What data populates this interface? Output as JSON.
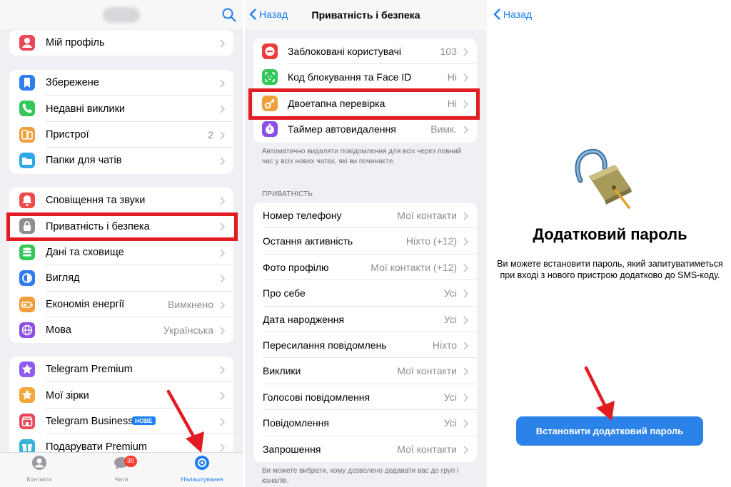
{
  "settings": {
    "profile_group": [
      {
        "label": "Мій профіль",
        "icon": "person-icon",
        "color": "#e9485b",
        "value": ""
      }
    ],
    "group2": [
      {
        "label": "Збережене",
        "icon": "bookmark-icon",
        "color": "#2f7bf0",
        "value": ""
      },
      {
        "label": "Недавні виклики",
        "icon": "phone-icon",
        "color": "#34c759",
        "value": ""
      },
      {
        "label": "Пристрої",
        "icon": "devices-icon",
        "color": "#f0a03a",
        "value": "2"
      },
      {
        "label": "Папки для чатів",
        "icon": "folder-icon",
        "color": "#2fa8e8",
        "value": ""
      }
    ],
    "group3": [
      {
        "label": "Сповіщення та звуки",
        "icon": "bell-icon",
        "color": "#ef4b4b",
        "value": ""
      },
      {
        "label": "Приватність і безпека",
        "icon": "lock-icon",
        "color": "#8e8e93",
        "value": ""
      },
      {
        "label": "Дані та сховище",
        "icon": "database-icon",
        "color": "#34c759",
        "value": ""
      },
      {
        "label": "Вигляд",
        "icon": "appearance-icon",
        "color": "#2f7bf0",
        "value": ""
      },
      {
        "label": "Економія енергії",
        "icon": "battery-icon",
        "color": "#f0a03a",
        "value": "Вимкнено"
      },
      {
        "label": "Мова",
        "icon": "globe-icon",
        "color": "#8e4ee6",
        "value": "Українська"
      }
    ],
    "group4": [
      {
        "label": "Telegram Premium",
        "icon": "premium-star-icon",
        "color": "#8e5cf0",
        "value": ""
      },
      {
        "label": "Мої зірки",
        "icon": "star-icon",
        "color": "#f0a93a",
        "value": ""
      },
      {
        "label": "Telegram Business",
        "icon": "business-icon",
        "color": "#e9485b",
        "value": "",
        "badge": "НОВЕ"
      },
      {
        "label": "Подарувати Premium",
        "icon": "gift-icon",
        "color": "#34b4d9",
        "value": ""
      }
    ],
    "tabbar": {
      "contacts": "Контакти",
      "chats": "Чати",
      "chats_badge": "30",
      "settings": "Налаштування"
    }
  },
  "privacy": {
    "back": "Назад",
    "title": "Приватність і безпека",
    "security_rows": [
      {
        "label": "Заблоковані користувачі",
        "icon": "blocked-icon",
        "color": "#ef3b3b",
        "value": "103"
      },
      {
        "label": "Код блокування та Face ID",
        "icon": "faceid-icon",
        "color": "#34c759",
        "value": "Ні"
      },
      {
        "label": "Двоетапна перевірка",
        "icon": "key-icon",
        "color": "#f0a03a",
        "value": "Ні"
      },
      {
        "label": "Таймер автовидалення",
        "icon": "timer-icon",
        "color": "#8e4ee6",
        "value": "Вимк."
      }
    ],
    "security_note": "Автоматично видаляти повідомлення для всіх через певний час у всіх нових чатах, які ви починаєте.",
    "privacy_header": "ПРИВАТНІСТЬ",
    "privacy_rows": [
      {
        "label": "Номер телефону",
        "value": "Мої контакти"
      },
      {
        "label": "Остання активність",
        "value": "Ніхто (+12)"
      },
      {
        "label": "Фото профілю",
        "value": "Мої контакти (+12)"
      },
      {
        "label": "Про себе",
        "value": "Усі"
      },
      {
        "label": "Дата народження",
        "value": "Усі"
      },
      {
        "label": "Пересилання повідомлень",
        "value": "Ніхто"
      },
      {
        "label": "Виклики",
        "value": "Мої контакти"
      },
      {
        "label": "Голосові повідомлення",
        "value": "Усі"
      },
      {
        "label": "Повідомлення",
        "value": "Усі"
      },
      {
        "label": "Запрошення",
        "value": "Мої контакти"
      }
    ],
    "privacy_note": "Ви можете вибрати, кому дозволено додавати вас до груп і каналів."
  },
  "password": {
    "back": "Назад",
    "title": "Додатковий пароль",
    "description": "Ви можете встановити пароль, який запитуватиметься при вході з нового пристрою додатково до SMS-коду.",
    "button": "Встановити додатковий пароль"
  },
  "accent": "#1c7ef5",
  "highlight_color": "#e21c23"
}
